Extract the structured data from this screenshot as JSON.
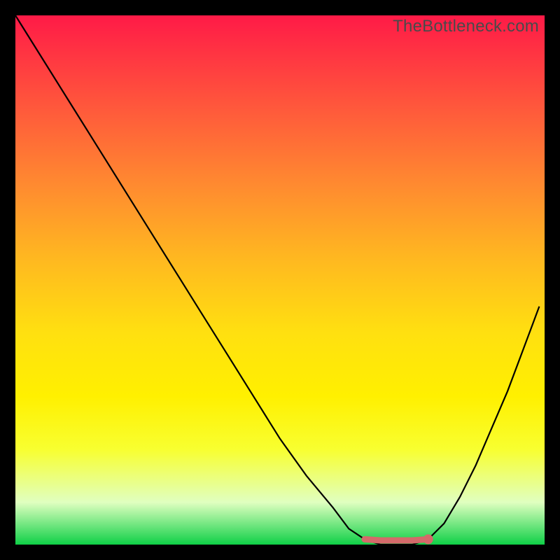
{
  "watermark": "TheBottleneck.com",
  "chart_data": {
    "type": "line",
    "title": "",
    "xlabel": "",
    "ylabel": "",
    "xlim": [
      0,
      100
    ],
    "ylim": [
      0,
      100
    ],
    "series": [
      {
        "name": "bottleneck-curve",
        "x": [
          0,
          5,
          10,
          15,
          20,
          25,
          30,
          35,
          40,
          45,
          50,
          55,
          60,
          63,
          66,
          69,
          72,
          75,
          78,
          81,
          84,
          87,
          90,
          93,
          96,
          99
        ],
        "y": [
          100,
          92,
          84,
          76,
          68,
          60,
          52,
          44,
          36,
          28,
          20,
          13,
          7,
          3,
          1,
          0,
          0,
          0,
          1,
          4,
          9,
          15,
          22,
          29,
          37,
          45
        ]
      }
    ],
    "annotations": [
      {
        "name": "optimal-resolution-marker",
        "x": 78,
        "y": 1,
        "color": "#d46a6a"
      }
    ],
    "gradient_stops": [
      {
        "pos": 0.0,
        "color": "#ff1a47"
      },
      {
        "pos": 0.32,
        "color": "#ff8a30"
      },
      {
        "pos": 0.6,
        "color": "#ffe010"
      },
      {
        "pos": 0.82,
        "color": "#f8ff30"
      },
      {
        "pos": 1.0,
        "color": "#0fd047"
      }
    ]
  }
}
